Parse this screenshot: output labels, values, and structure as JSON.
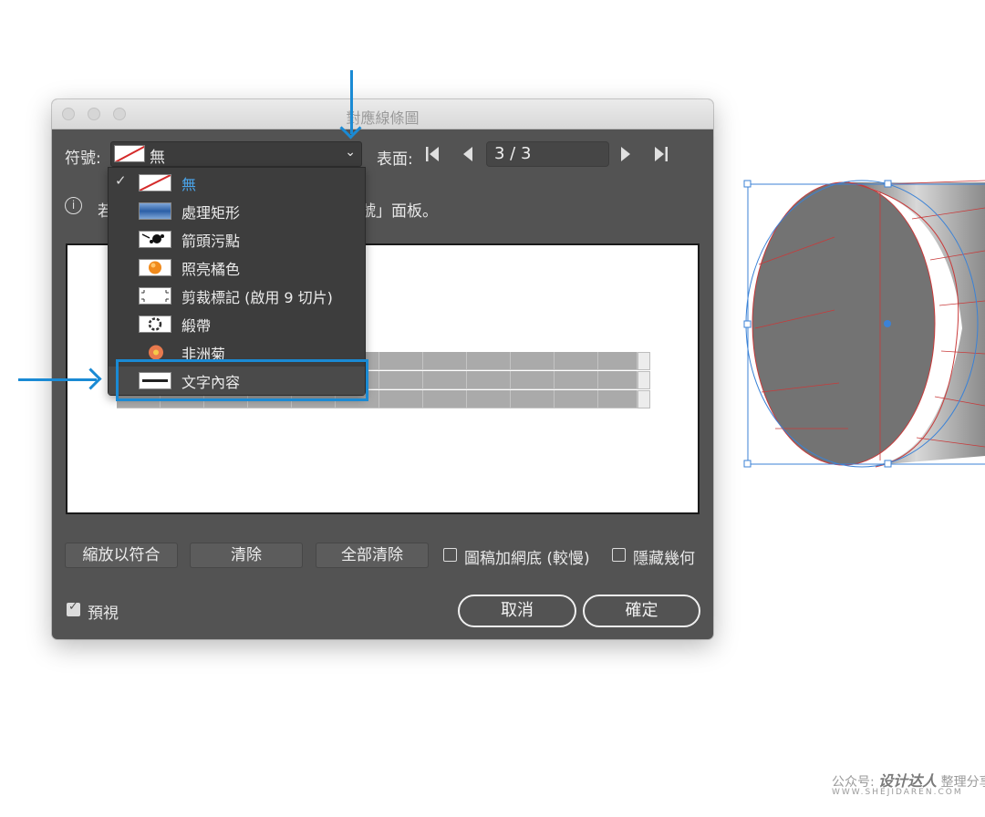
{
  "window": {
    "title": "對應線條圖"
  },
  "toolbar": {
    "symbol_label": "符號:",
    "symbol_value": "無",
    "surface_label": "表面:",
    "page_value": "3 / 3"
  },
  "info": {
    "text_left": "若",
    "text_right": "號」面板。"
  },
  "symbol_menu": {
    "items": [
      {
        "label": "無",
        "icon": "none-swatch-icon",
        "checked": true
      },
      {
        "label": "處理矩形",
        "icon": "shaded-rectangle-icon",
        "checked": false
      },
      {
        "label": "箭頭污點",
        "icon": "arrow-blot-icon",
        "checked": false
      },
      {
        "label": "照亮橘色",
        "icon": "orange-sphere-icon",
        "checked": false
      },
      {
        "label": "剪裁標記 (啟用 9 切片)",
        "icon": "crop-marks-icon",
        "checked": false
      },
      {
        "label": "緞帶",
        "icon": "ribbon-icon",
        "checked": false
      },
      {
        "label": "非洲菊",
        "icon": "daisy-icon",
        "checked": false
      },
      {
        "label": "文字內容",
        "icon": "text-content-icon",
        "checked": false,
        "highlighted": true
      }
    ]
  },
  "buttons": {
    "fit": "縮放以符合",
    "clear": "清除",
    "clear_all": "全部清除",
    "cancel": "取消",
    "ok": "確定"
  },
  "options": {
    "shade_artwork": {
      "label": "圖稿加網底 (較慢)",
      "checked": false
    },
    "invisible_geometry": {
      "label": "隱藏幾何",
      "checked": false
    },
    "preview": {
      "label": "預視",
      "checked": true
    }
  },
  "colors": {
    "dialog_bg": "#535353",
    "highlight": "#1a8ad4",
    "menu_selected_text": "#4aa3e8"
  },
  "watermark": {
    "prefix": "公众号:",
    "brand": "设计达人",
    "suffix": "整理分享",
    "url": "WWW.SHEJIDAREN.COM"
  }
}
